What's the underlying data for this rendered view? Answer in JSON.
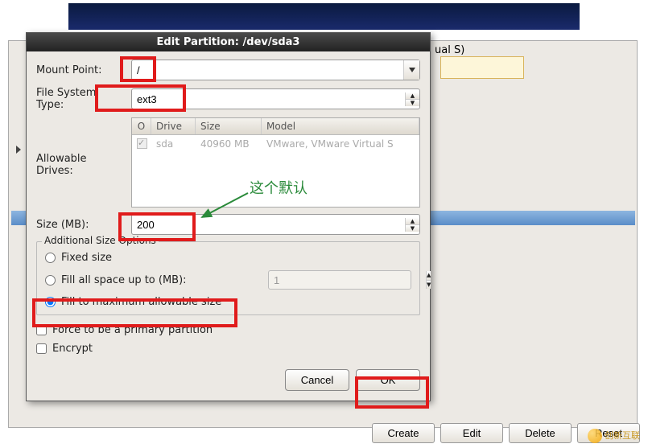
{
  "background": {
    "model_fragment": "ual S)",
    "buttons": {
      "create": "Create",
      "edit": "Edit",
      "delete": "Delete",
      "reset": "Reset"
    }
  },
  "dialog": {
    "title": "Edit Partition: /dev/sda3",
    "mount_label": "Mount Point:",
    "mount_value": "/",
    "fstype_label": "File System Type:",
    "fstype_value": "ext3",
    "drives_label": "Allowable Drives:",
    "drives": {
      "header_chk": "O",
      "header_drive": "Drive",
      "header_size": "Size",
      "header_model": "Model",
      "row": {
        "drive": "sda",
        "size": "40960 MB",
        "model": "VMware, VMware Virtual S"
      }
    },
    "size_label": "Size (MB):",
    "size_value": "200",
    "additional": {
      "title": "Additional Size Options",
      "fixed": "Fixed size",
      "fill_up_to": "Fill all space up to (MB):",
      "fill_up_to_value": "1",
      "fill_max": "Fill to maximum allowable size",
      "selected": "fill_max"
    },
    "force_primary": "Force to be a primary partition",
    "encrypt": "Encrypt",
    "buttons": {
      "cancel": "Cancel",
      "ok": "OK"
    }
  },
  "annotation": {
    "text": "这个默认"
  },
  "watermark": "创新互联"
}
